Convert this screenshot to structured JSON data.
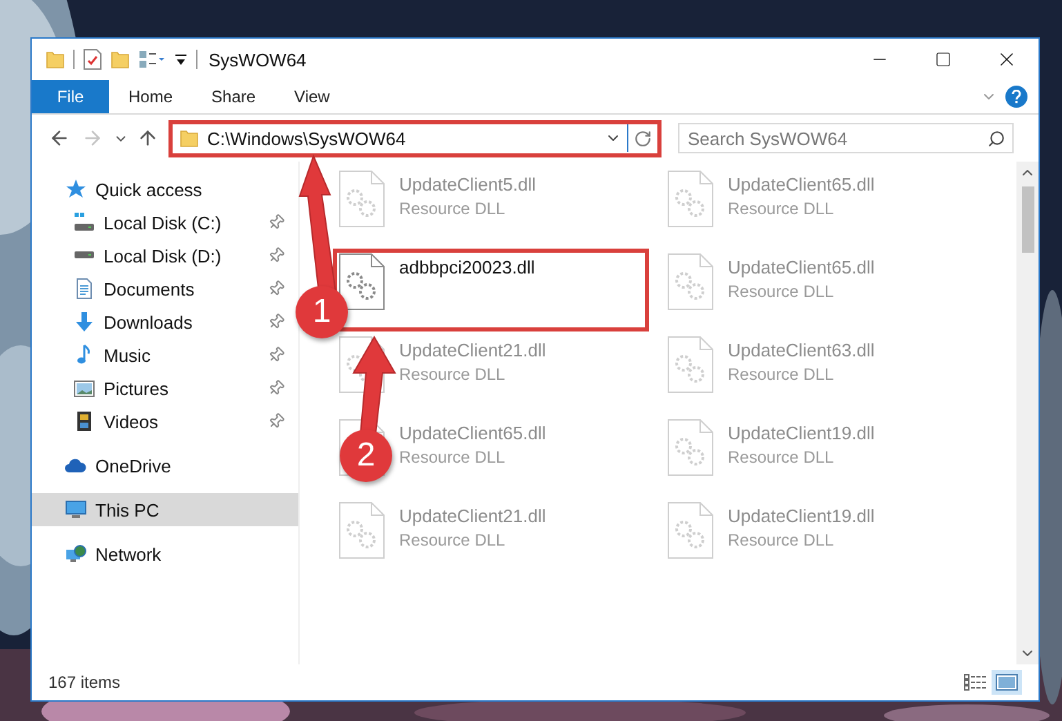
{
  "window": {
    "title": "SysWOW64"
  },
  "ribbon": {
    "file_tab": "File",
    "tabs": [
      "Home",
      "Share",
      "View"
    ]
  },
  "address": {
    "path": "C:\\Windows\\SysWOW64",
    "highlighted": true
  },
  "search": {
    "placeholder": "Search SysWOW64"
  },
  "sidebar": {
    "items": [
      {
        "label": "Quick access",
        "kind": "star",
        "selected": false,
        "children": [
          {
            "label": "Local Disk (C:)",
            "kind": "system-drive",
            "pinned": true,
            "selected": false
          },
          {
            "label": "Local Disk (D:)",
            "kind": "drive",
            "pinned": true,
            "selected": false
          },
          {
            "label": "Documents",
            "kind": "documents",
            "pinned": true,
            "selected": false
          },
          {
            "label": "Downloads",
            "kind": "downloads",
            "pinned": true,
            "selected": false
          },
          {
            "label": "Music",
            "kind": "music",
            "pinned": true,
            "selected": false
          },
          {
            "label": "Pictures",
            "kind": "pictures",
            "pinned": true,
            "selected": false
          },
          {
            "label": "Videos",
            "kind": "videos",
            "pinned": true,
            "selected": false
          }
        ]
      },
      {
        "label": "OneDrive",
        "kind": "cloud",
        "selected": false
      },
      {
        "label": "This PC",
        "kind": "computer",
        "selected": true
      },
      {
        "label": "Network",
        "kind": "network",
        "selected": false
      }
    ]
  },
  "files": [
    {
      "name": "UpdateClient5.dll",
      "type": "Resource DLL",
      "faded": true,
      "highlighted": false
    },
    {
      "name": "UpdateClient65.dll",
      "type": "Resource DLL",
      "faded": true,
      "highlighted": false
    },
    {
      "name": "adbbpci20023.dll",
      "faded": false,
      "highlighted": true
    },
    {
      "name": "UpdateClient65.dll",
      "type": "Resource DLL",
      "faded": true,
      "highlighted": false
    },
    {
      "name": "UpdateClient21.dll",
      "type": "Resource DLL",
      "faded": true,
      "highlighted": false
    },
    {
      "name": "UpdateClient63.dll",
      "type": "Resource DLL",
      "faded": true,
      "highlighted": false
    },
    {
      "name": "UpdateClient65.dll",
      "type": "Resource DLL",
      "faded": true,
      "highlighted": false
    },
    {
      "name": "UpdateClient19.dll",
      "type": "Resource DLL",
      "faded": true,
      "highlighted": false
    },
    {
      "name": "UpdateClient21.dll",
      "type": "Resource DLL",
      "faded": true,
      "highlighted": false
    },
    {
      "name": "UpdateClient19.dll",
      "type": "Resource DLL",
      "faded": true,
      "highlighted": false
    }
  ],
  "status_bar": {
    "count": "167 items"
  },
  "annotations": [
    {
      "number": "1"
    },
    {
      "number": "2"
    }
  ]
}
